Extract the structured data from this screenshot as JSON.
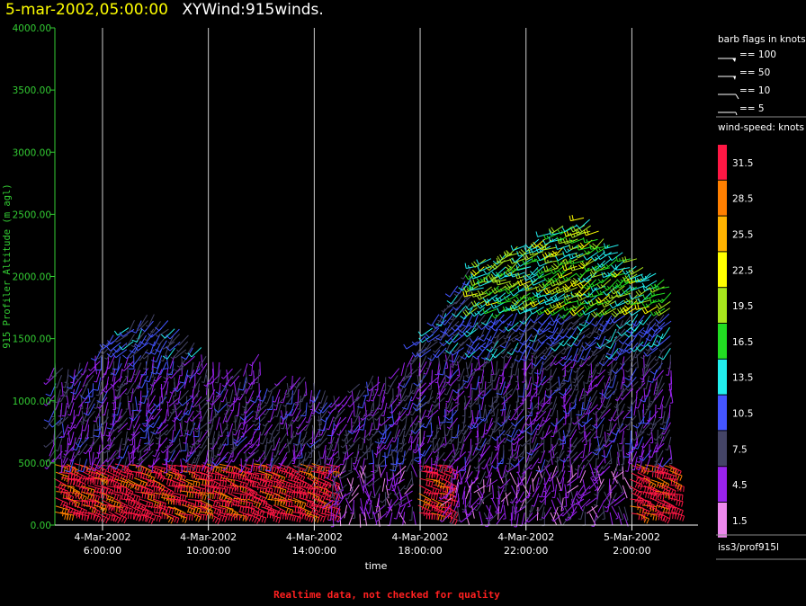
{
  "header": {
    "datetime": "5-mar-2002,05:00:00",
    "product": "XYWind:915winds."
  },
  "footer_note": "Realtime data, not checked for quality",
  "chart_data": {
    "type": "wind-barb time-height",
    "xlabel": "time",
    "ylabel": "915 Profiler Altitude (m agl)",
    "ylim": [
      0,
      4000
    ],
    "yticks": [
      "0.00",
      "500.00",
      "1000.00",
      "1500.00",
      "2000.00",
      "2500.00",
      "3000.00",
      "3500.00",
      "4000.00"
    ],
    "xrange_hours": [
      4.2,
      28.5
    ],
    "xticks": [
      {
        "hour": 6,
        "date": "4-Mar-2002",
        "time": "6:00:00"
      },
      {
        "hour": 10,
        "date": "4-Mar-2002",
        "time": "10:00:00"
      },
      {
        "hour": 14,
        "date": "4-Mar-2002",
        "time": "14:00:00"
      },
      {
        "hour": 18,
        "date": "4-Mar-2002",
        "time": "18:00:00"
      },
      {
        "hour": 22,
        "date": "4-Mar-2002",
        "time": "22:00:00"
      },
      {
        "hour": 26,
        "date": "5-Mar-2002",
        "time": "2:00:00"
      }
    ],
    "gridlines_vertical": true,
    "barb_legend": {
      "title": "barb flags in knots",
      "items": [
        "== 100",
        "== 50",
        "== 10",
        "== 5"
      ]
    },
    "speed_legend": {
      "title": "wind-speed: knots",
      "bins": [
        {
          "label": "31.5",
          "color": "#ff1744"
        },
        {
          "label": "28.5",
          "color": "#ff7f00"
        },
        {
          "label": "25.5",
          "color": "#ffb300"
        },
        {
          "label": "22.5",
          "color": "#ffff00"
        },
        {
          "label": "19.5",
          "color": "#a8e61d"
        },
        {
          "label": "16.5",
          "color": "#22dd22"
        },
        {
          "label": "13.5",
          "color": "#22eeee"
        },
        {
          "label": "10.5",
          "color": "#4455ff"
        },
        {
          "label": "7.5",
          "color": "#444466"
        },
        {
          "label": "4.5",
          "color": "#9922ee"
        },
        {
          "label": "1.5",
          "color": "#ee88ee"
        }
      ]
    },
    "source": "iss3/prof915l"
  }
}
